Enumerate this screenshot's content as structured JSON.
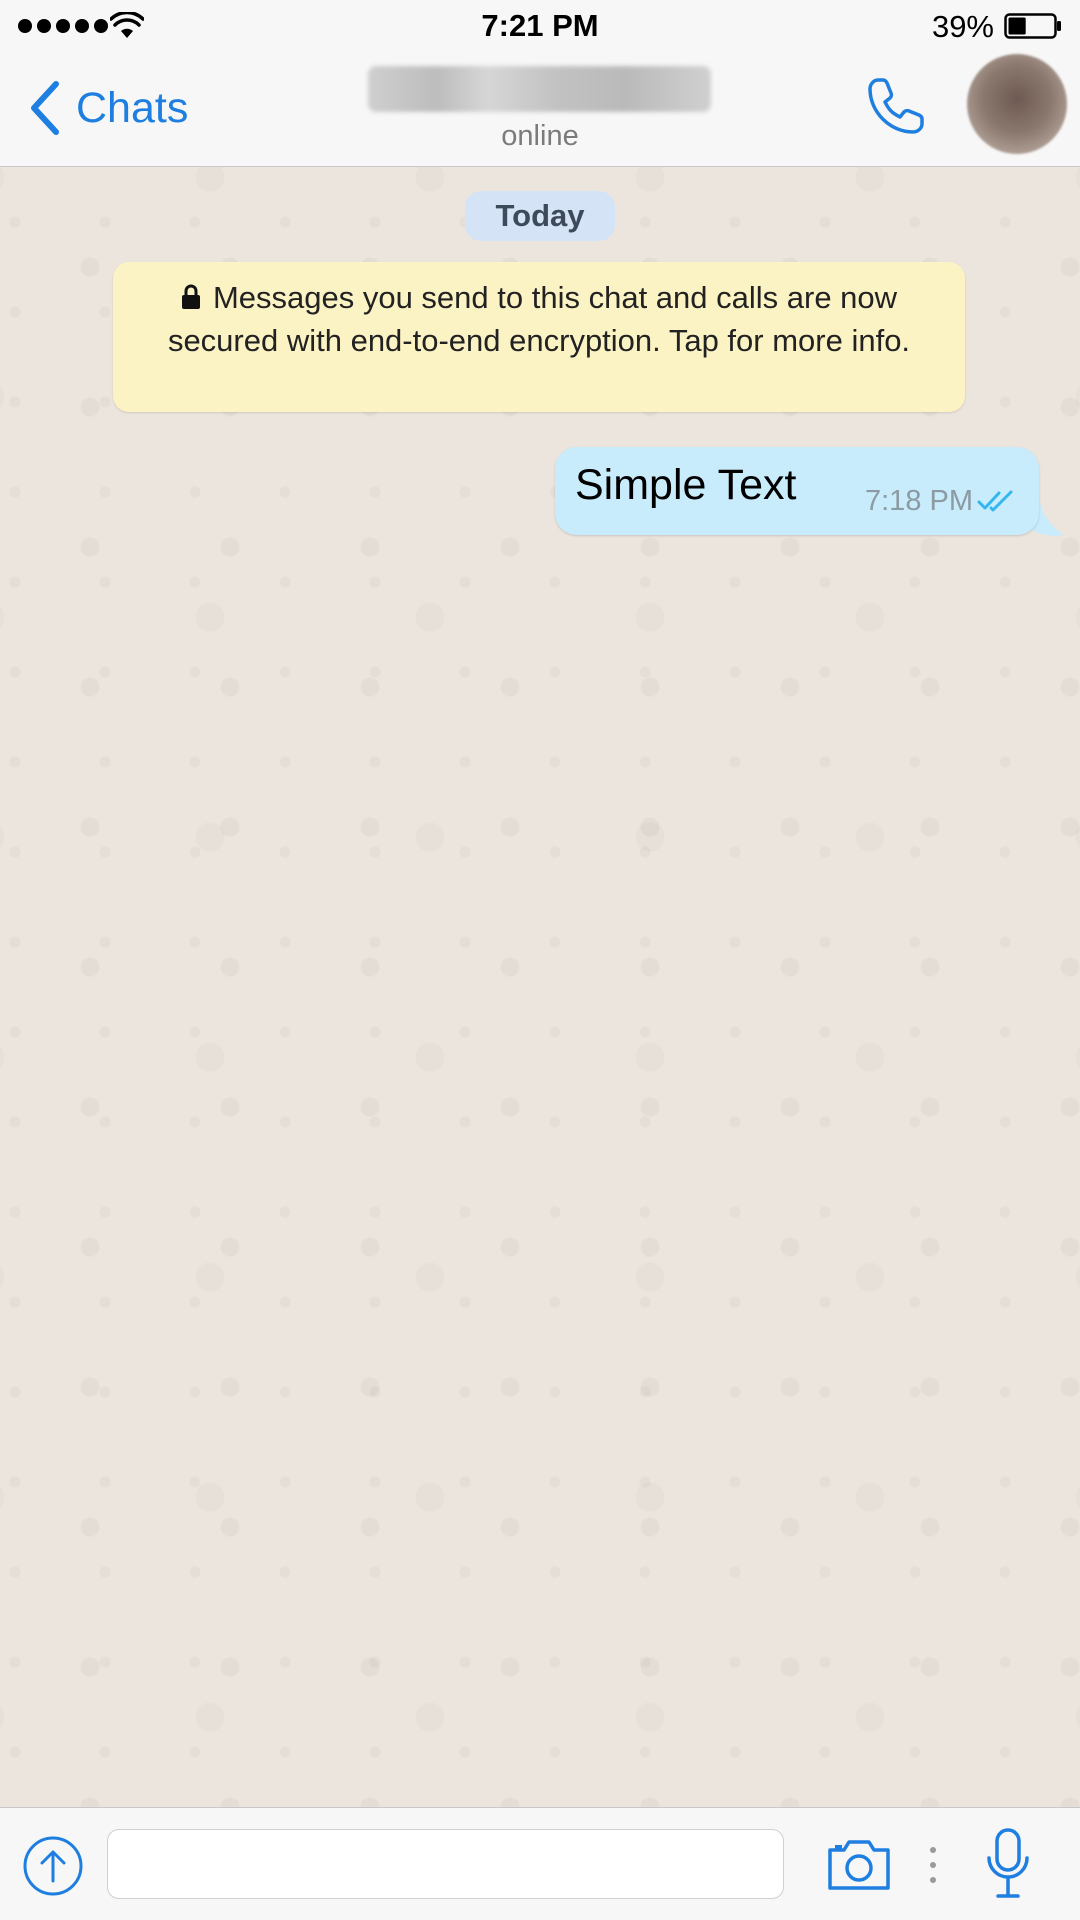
{
  "status_bar": {
    "time": "7:21 PM",
    "battery_percent": "39%",
    "battery_level": 0.39,
    "signal_bars": 5,
    "icons": [
      "signal-dots-icon",
      "wifi-icon",
      "battery-icon"
    ]
  },
  "nav": {
    "back_label": "Chats",
    "contact_status": "online",
    "icons": [
      "back-chevron-icon",
      "phone-icon"
    ]
  },
  "chat": {
    "date_label": "Today",
    "encryption_notice": "Messages you send to this chat and calls are now secured with end-to-end encryption. Tap for more info.",
    "messages": [
      {
        "text": "Simple Text",
        "time": "7:18 PM",
        "direction": "outgoing",
        "status": "read"
      }
    ]
  },
  "input": {
    "value": "",
    "placeholder": "",
    "icons": [
      "attach-upload-icon",
      "camera-icon",
      "more-dots-icon",
      "microphone-icon"
    ]
  },
  "colors": {
    "accent": "#1e7fe0",
    "chat_background": "#ece5dd",
    "outgoing_bubble": "#c8ecfb",
    "notice_background": "#fcf3c4",
    "date_chip": "#d4e3f6",
    "read_receipt": "#34b7f1"
  }
}
